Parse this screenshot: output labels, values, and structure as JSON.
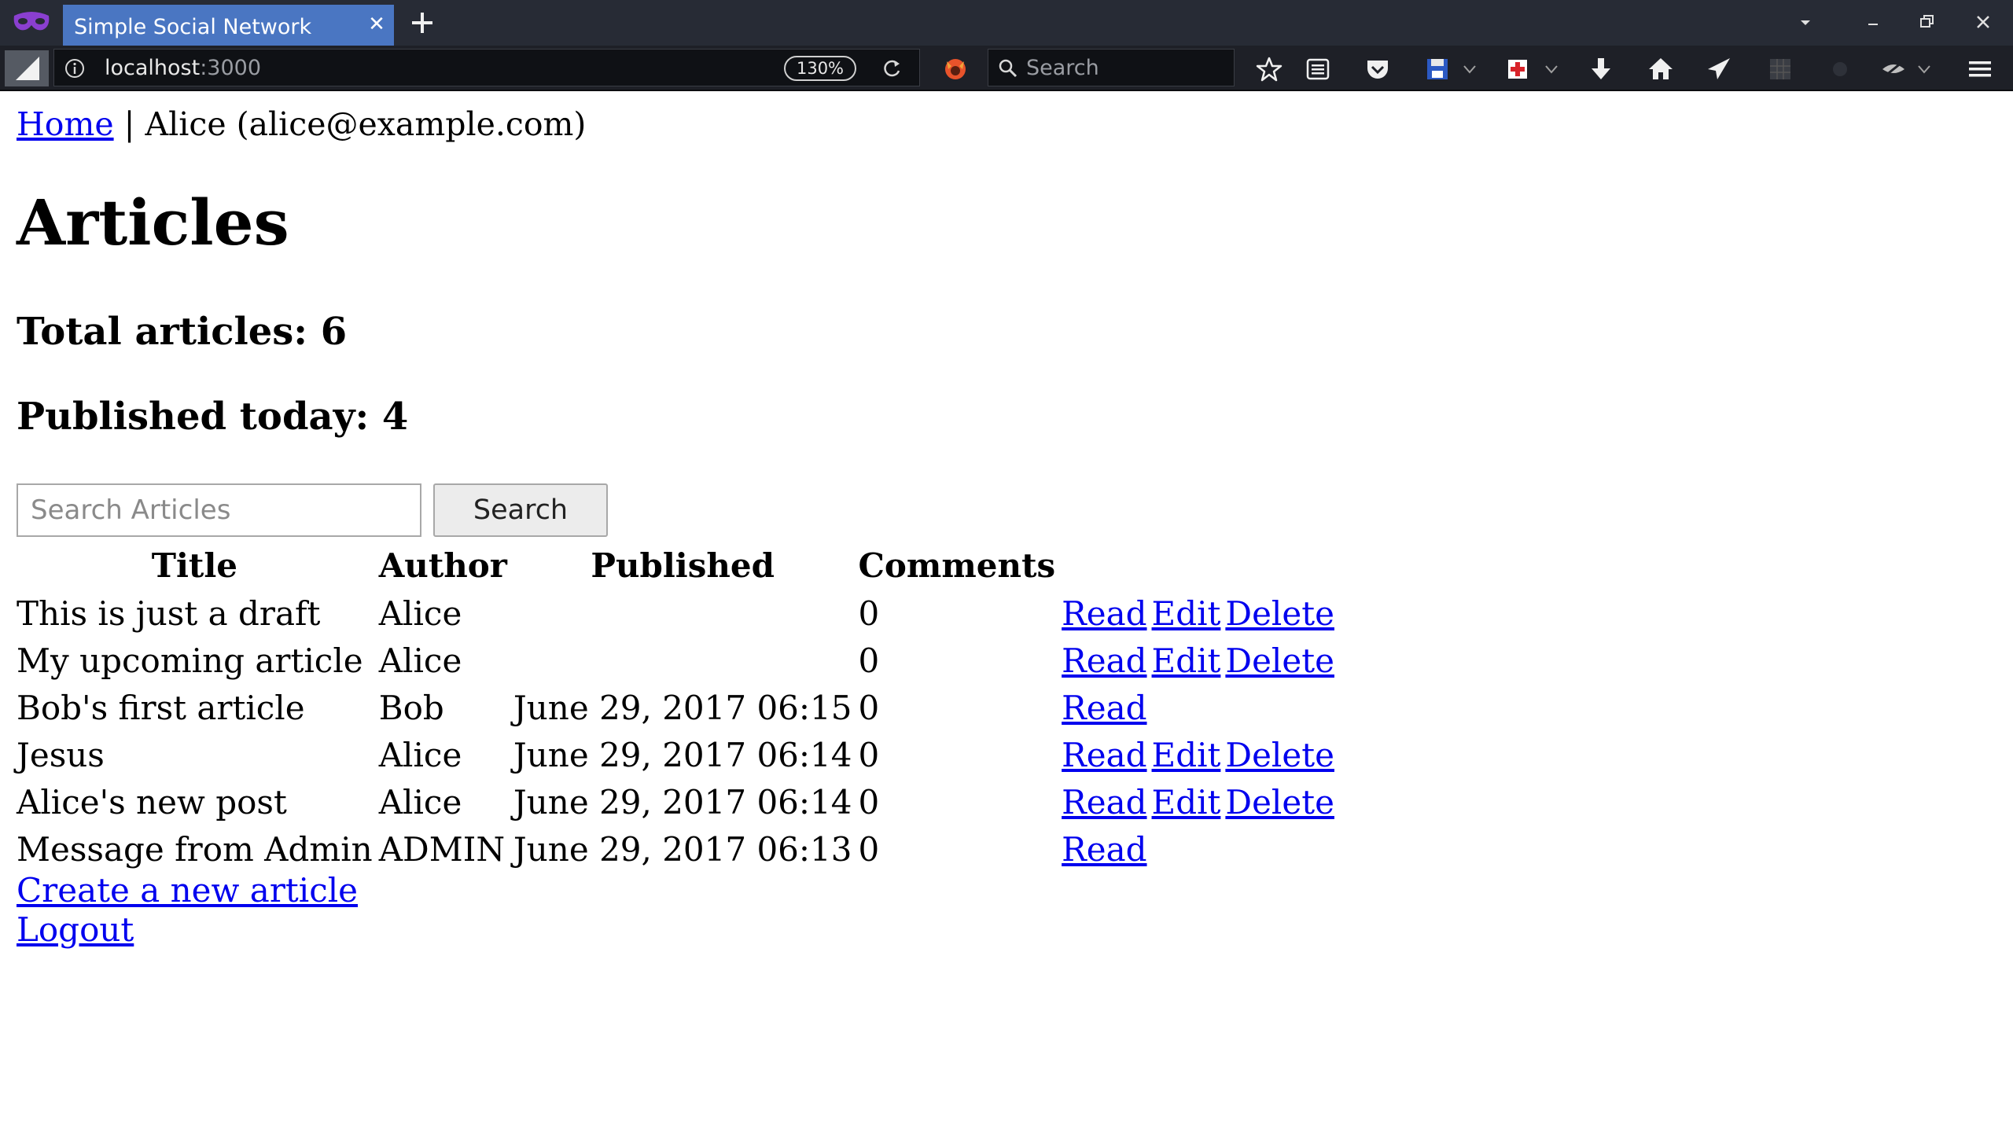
{
  "browser": {
    "tab_title": "Simple Social Network",
    "url_host": "localhost",
    "url_port": ":3000",
    "zoom": "130%",
    "search_placeholder": "Search"
  },
  "nav": {
    "home_link": "Home",
    "separator": "|",
    "user": "Alice (alice@example.com)"
  },
  "page": {
    "title": "Articles",
    "total_articles": "Total articles: 6",
    "published_today": "Published today: 4"
  },
  "search": {
    "placeholder": "Search Articles",
    "button_label": "Search"
  },
  "table": {
    "headers": [
      "Title",
      "Author",
      "Published",
      "Comments"
    ],
    "rows": [
      {
        "title": "This is just a draft",
        "author": "Alice",
        "published": "",
        "comments": "0",
        "read": "Read",
        "edit": "Edit",
        "delete": "Delete"
      },
      {
        "title": "My upcoming article",
        "author": "Alice",
        "published": "",
        "comments": "0",
        "read": "Read",
        "edit": "Edit",
        "delete": "Delete"
      },
      {
        "title": "Bob's first article",
        "author": "Bob",
        "published": "June 29, 2017 06:15",
        "comments": "0",
        "read": "Read",
        "edit": "",
        "delete": ""
      },
      {
        "title": "Jesus",
        "author": "Alice",
        "published": "June 29, 2017 06:14",
        "comments": "0",
        "read": "Read",
        "edit": "Edit",
        "delete": "Delete"
      },
      {
        "title": "Alice's new post",
        "author": "Alice",
        "published": "June 29, 2017 06:14",
        "comments": "0",
        "read": "Read",
        "edit": "Edit",
        "delete": "Delete"
      },
      {
        "title": "Message from Admin",
        "author": "ADMIN",
        "published": "June 29, 2017 06:13",
        "comments": "0",
        "read": "Read",
        "edit": "",
        "delete": ""
      }
    ]
  },
  "footer": {
    "create_link": "Create a new article",
    "logout_link": "Logout"
  },
  "colors": {
    "tab_active": "#4a76c2",
    "chrome_dark": "#272b35",
    "link": "#0000ee"
  }
}
